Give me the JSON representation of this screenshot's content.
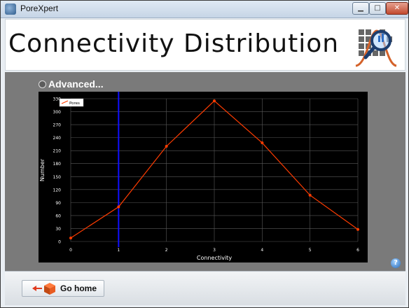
{
  "window": {
    "title": "PoreXpert",
    "min_glyph": "▁",
    "max_glyph": "□",
    "close_glyph": "✕"
  },
  "header": {
    "title": "Connectivity Distribution"
  },
  "advanced": {
    "label": "Advanced..."
  },
  "help": {
    "glyph": "?"
  },
  "footer": {
    "go_home_label": "Go home"
  },
  "colors": {
    "series": "#ff3c00",
    "cursor": "#1010ff",
    "grid": "#5a5a5a"
  },
  "chart_data": {
    "type": "line",
    "xlabel": "Connectivity",
    "ylabel": "Number",
    "xlim": [
      0,
      6
    ],
    "ylim": [
      0,
      330
    ],
    "xticks": [
      0,
      1,
      2,
      3,
      4,
      5,
      6
    ],
    "yticks": [
      0,
      30,
      60,
      90,
      120,
      150,
      180,
      210,
      240,
      270,
      300,
      330
    ],
    "grid": true,
    "legend_position": "top-left",
    "cursor_x": 1,
    "series": [
      {
        "name": "Pores",
        "x": [
          0,
          1,
          2,
          3,
          4,
          5,
          6
        ],
        "y": [
          8,
          80,
          220,
          325,
          228,
          107,
          28
        ]
      }
    ]
  }
}
